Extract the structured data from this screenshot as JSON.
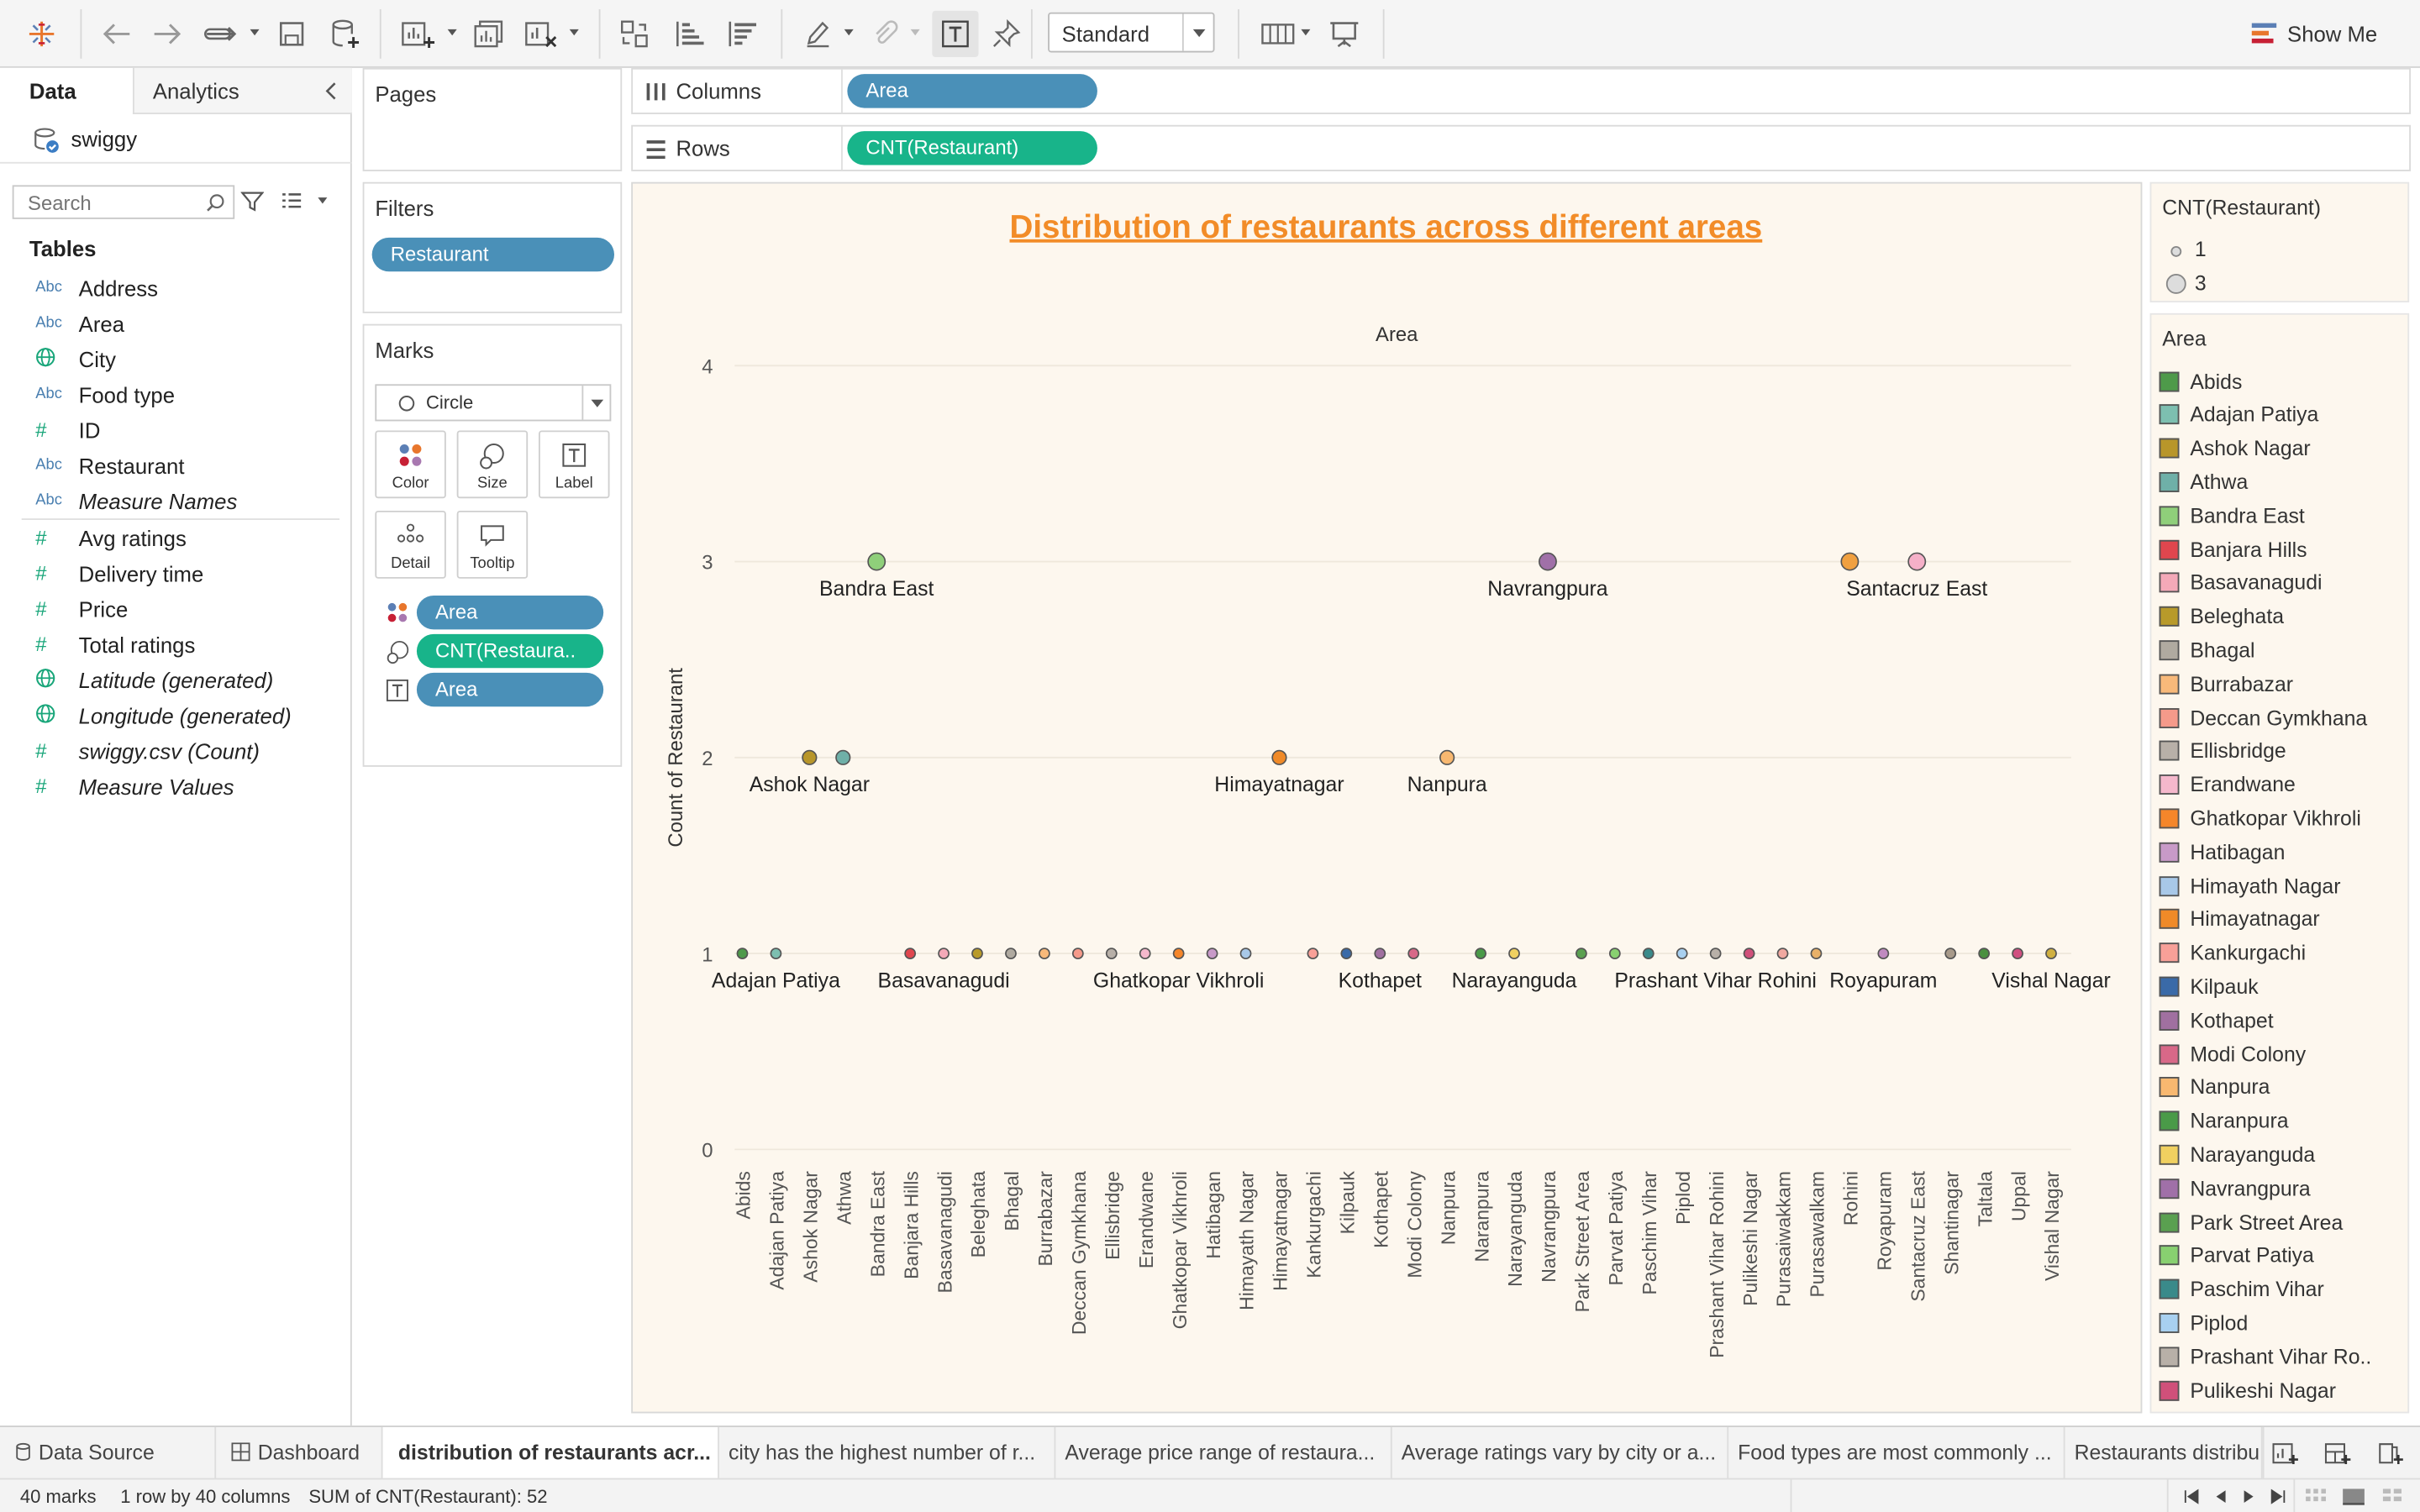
{
  "toolbar": {
    "view_mode": "Standard",
    "show_me_label": "Show Me"
  },
  "data_pane": {
    "tab_data": "Data",
    "tab_analytics": "Analytics",
    "datasource": "swiggy",
    "search_placeholder": "Search",
    "tables_heading": "Tables",
    "fields": [
      {
        "icon": "Abc",
        "name": "Address",
        "italic": false
      },
      {
        "icon": "Abc",
        "name": "Area",
        "italic": false
      },
      {
        "icon": "globe",
        "name": "City",
        "italic": false
      },
      {
        "icon": "Abc",
        "name": "Food type",
        "italic": false
      },
      {
        "icon": "#",
        "name": "ID",
        "italic": false
      },
      {
        "icon": "Abc",
        "name": "Restaurant",
        "italic": false
      },
      {
        "icon": "Abc",
        "name": "Measure Names",
        "italic": true
      },
      {
        "icon": "#",
        "name": "Avg ratings",
        "italic": false
      },
      {
        "icon": "#",
        "name": "Delivery time",
        "italic": false
      },
      {
        "icon": "#",
        "name": "Price",
        "italic": false
      },
      {
        "icon": "#",
        "name": "Total ratings",
        "italic": false
      },
      {
        "icon": "globe",
        "name": "Latitude (generated)",
        "italic": true
      },
      {
        "icon": "globe",
        "name": "Longitude (generated)",
        "italic": true
      },
      {
        "icon": "#",
        "name": "swiggy.csv (Count)",
        "italic": true
      },
      {
        "icon": "#",
        "name": "Measure Values",
        "italic": true
      }
    ]
  },
  "pages_label": "Pages",
  "filters": {
    "label": "Filters",
    "pills": [
      "Restaurant"
    ]
  },
  "marks": {
    "label": "Marks",
    "mark_type": "Circle",
    "cards": [
      "Color",
      "Size",
      "Label",
      "Detail",
      "Tooltip"
    ],
    "pills": [
      {
        "icon": "color",
        "text": "Area",
        "color": "blue"
      },
      {
        "icon": "size",
        "text": "CNT(Restaura..",
        "color": "green"
      },
      {
        "icon": "label",
        "text": "Area",
        "color": "blue"
      }
    ]
  },
  "shelves": {
    "columns_label": "Columns",
    "columns_pill": "Area",
    "rows_label": "Rows",
    "rows_pill": "CNT(Restaurant)"
  },
  "chart_data": {
    "type": "scatter",
    "title": "Distribution of restaurants across different areas",
    "column_header": "Area",
    "ylabel": "Count of Restaurant",
    "ylim": [
      0,
      4
    ],
    "yticks": [
      "0",
      "1",
      "2",
      "3",
      "4"
    ],
    "categories": [
      "Abids",
      "Adajan Patiya",
      "Ashok Nagar",
      "Athwa",
      "Bandra East",
      "Banjara Hills",
      "Basavanagudi",
      "Beleghata",
      "Bhagal",
      "Burrabazar",
      "Deccan Gymkhana",
      "Ellisbridge",
      "Erandwane",
      "Ghatkopar Vikhroli",
      "Hatibagan",
      "Himayath Nagar",
      "Himayatnagar",
      "Kankurgachi",
      "Kilpauk",
      "Kothapet",
      "Modi Colony",
      "Nanpura",
      "Naranpura",
      "Narayanguda",
      "Navrangpura",
      "Park Street Area",
      "Parvat Patiya",
      "Paschim Vihar",
      "Piplod",
      "Prashant Vihar Rohini",
      "Pulikeshi Nagar",
      "Purasaiwakkam",
      "Purasawalkam",
      "Rohini",
      "Royapuram",
      "Santacruz East",
      "Shantinagar",
      "Taltala",
      "Uppal",
      "Vishal Nagar"
    ],
    "values": [
      1,
      1,
      2,
      2,
      3,
      1,
      1,
      1,
      1,
      1,
      1,
      1,
      1,
      1,
      1,
      1,
      2,
      1,
      1,
      1,
      1,
      2,
      1,
      1,
      3,
      1,
      1,
      1,
      1,
      1,
      1,
      1,
      1,
      3,
      1,
      3,
      1,
      1,
      1,
      1
    ],
    "colors": [
      "#4e9a4a",
      "#7dbfb0",
      "#b8962a",
      "#6fb0a8",
      "#8fcf7a",
      "#e0464e",
      "#f4a9b8",
      "#b89a2a",
      "#b0aaa0",
      "#f8b97a",
      "#f59a8a",
      "#b8b0a8",
      "#f5b8cc",
      "#f5862a",
      "#c89ac8",
      "#a8c8e8",
      "#f08a28",
      "#f8a098",
      "#3a6aa8",
      "#a070a0",
      "#d86888",
      "#f8b870",
      "#4a9a48",
      "#f0d060",
      "#a070a8",
      "#5aa050",
      "#88d070",
      "#3a8a8a",
      "#a8d0f0",
      "#b8b0a8",
      "#d0507a",
      "#f0a8a0",
      "#e8b068",
      "#f0a040",
      "#c08ac0",
      "#f5b0c8",
      "#a89a8a",
      "#4a9040",
      "#d05080",
      "#d0b040"
    ],
    "point_labels": [
      {
        "index": 1,
        "text": "Adajan Patiya"
      },
      {
        "index": 2,
        "text": "Ashok Nagar"
      },
      {
        "index": 4,
        "text": "Bandra East"
      },
      {
        "index": 6,
        "text": "Basavanagudi"
      },
      {
        "index": 13,
        "text": "Ghatkopar Vikhroli"
      },
      {
        "index": 16,
        "text": "Himayatnagar"
      },
      {
        "index": 19,
        "text": "Kothapet"
      },
      {
        "index": 21,
        "text": "Nanpura"
      },
      {
        "index": 23,
        "text": "Narayanguda"
      },
      {
        "index": 24,
        "text": "Navrangpura"
      },
      {
        "index": 29,
        "text": "Prashant Vihar Rohini"
      },
      {
        "index": 34,
        "text": "Royapuram"
      },
      {
        "index": 35,
        "text": "Santacruz East"
      },
      {
        "index": 39,
        "text": "Vishal Nagar"
      }
    ]
  },
  "size_legend": {
    "title": "CNT(Restaurant)",
    "items": [
      "1",
      "3"
    ]
  },
  "color_legend": {
    "title": "Area",
    "items": [
      {
        "name": "Abids",
        "color": "#4e9a4a"
      },
      {
        "name": "Adajan Patiya",
        "color": "#7dbfb0"
      },
      {
        "name": "Ashok Nagar",
        "color": "#b8962a"
      },
      {
        "name": "Athwa",
        "color": "#6fb0a8"
      },
      {
        "name": "Bandra East",
        "color": "#8fcf7a"
      },
      {
        "name": "Banjara Hills",
        "color": "#e0464e"
      },
      {
        "name": "Basavanagudi",
        "color": "#f4a9b8"
      },
      {
        "name": "Beleghata",
        "color": "#b89a2a"
      },
      {
        "name": "Bhagal",
        "color": "#b0aaa0"
      },
      {
        "name": "Burrabazar",
        "color": "#f8b97a"
      },
      {
        "name": "Deccan Gymkhana",
        "color": "#f59a8a"
      },
      {
        "name": "Ellisbridge",
        "color": "#b8b0a8"
      },
      {
        "name": "Erandwane",
        "color": "#f5b8cc"
      },
      {
        "name": "Ghatkopar Vikhroli",
        "color": "#f5862a"
      },
      {
        "name": "Hatibagan",
        "color": "#c89ac8"
      },
      {
        "name": "Himayath Nagar",
        "color": "#a8c8e8"
      },
      {
        "name": "Himayatnagar",
        "color": "#f08a28"
      },
      {
        "name": "Kankurgachi",
        "color": "#f8a098"
      },
      {
        "name": "Kilpauk",
        "color": "#3a6aa8"
      },
      {
        "name": "Kothapet",
        "color": "#a070a0"
      },
      {
        "name": "Modi Colony",
        "color": "#d86888"
      },
      {
        "name": "Nanpura",
        "color": "#f8b870"
      },
      {
        "name": "Naranpura",
        "color": "#4a9a48"
      },
      {
        "name": "Narayanguda",
        "color": "#f0d060"
      },
      {
        "name": "Navrangpura",
        "color": "#a070a8"
      },
      {
        "name": "Park Street Area",
        "color": "#5aa050"
      },
      {
        "name": "Parvat Patiya",
        "color": "#88d070"
      },
      {
        "name": "Paschim Vihar",
        "color": "#3a8a8a"
      },
      {
        "name": "Piplod",
        "color": "#a8d0f0"
      },
      {
        "name": "Prashant Vihar Ro..",
        "color": "#b8b0a8"
      },
      {
        "name": "Pulikeshi Nagar",
        "color": "#d0507a"
      }
    ]
  },
  "sheet_tabs": [
    {
      "label": "Data Source",
      "icon": "db",
      "active": false
    },
    {
      "label": "Dashboard",
      "icon": "grid",
      "active": false
    },
    {
      "label": "distribution of restaurants acr...",
      "icon": "",
      "active": true
    },
    {
      "label": "city has the highest number of r...",
      "icon": "",
      "active": false
    },
    {
      "label": "Average price range of restaura...",
      "icon": "",
      "active": false
    },
    {
      "label": "Average ratings vary by city or a...",
      "icon": "",
      "active": false
    },
    {
      "label": "Food types are most commonly ...",
      "icon": "",
      "active": false
    },
    {
      "label": "Restaurants distribu",
      "icon": "",
      "active": false
    }
  ],
  "status": {
    "marks": "40 marks",
    "dims": "1 row by 40 columns",
    "sum": "SUM of CNT(Restaurant): 52"
  }
}
